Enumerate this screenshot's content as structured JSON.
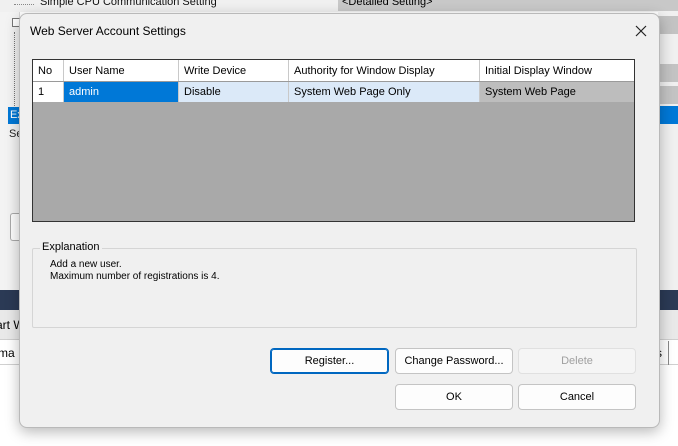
{
  "background": {
    "tree_item_label": "Simple CPU Communication Setting",
    "tree_item_value": "<Detailed Setting>",
    "left_row_label": "Ex",
    "left_text": "Se",
    "tab_text": "art W",
    "row2_text": "rma",
    "row2_right_text": "s"
  },
  "dialog": {
    "title": "Web Server Account Settings",
    "table": {
      "headers": [
        "No",
        "User Name",
        "Write Device",
        "Authority for Window Display",
        "Initial Display Window"
      ],
      "rows": [
        [
          "1",
          "admin",
          "Disable",
          "System Web Page Only",
          "System Web Page"
        ]
      ]
    },
    "explanation": {
      "label": "Explanation",
      "lines": [
        "Add a new user.",
        "Maximum number of registrations is 4."
      ]
    },
    "buttons": {
      "register": "Register...",
      "change_password": "Change Password...",
      "delete": "Delete",
      "ok": "OK",
      "cancel": "Cancel"
    }
  },
  "colors": {
    "selection": "#0078d7",
    "row_highlight": "#dbe9f8",
    "grid_empty": "#a9a9a9",
    "dialog_bg": "#f0f0f0"
  },
  "icons": [
    "close-icon"
  ]
}
